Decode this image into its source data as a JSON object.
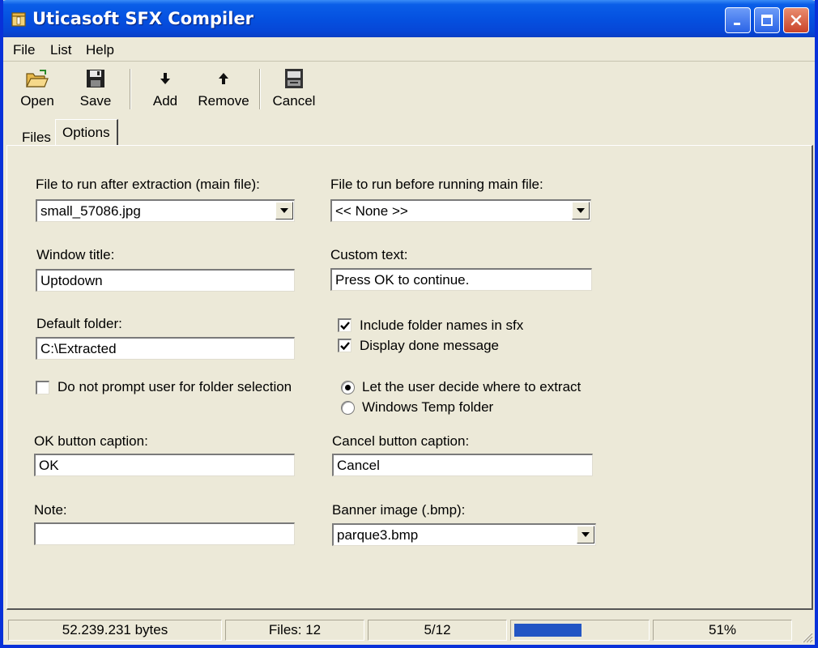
{
  "window": {
    "title": "Uticasoft SFX Compiler"
  },
  "menu": [
    "File",
    "List",
    "Help"
  ],
  "toolbar": {
    "open": "Open",
    "save": "Save",
    "add": "Add",
    "remove": "Remove",
    "cancel": "Cancel"
  },
  "tabs": {
    "files": "Files",
    "options": "Options"
  },
  "options": {
    "main_file_label": "File to run after extraction (main file):",
    "main_file_value": "small_57086.jpg",
    "pre_file_label": "File to run before running main file:",
    "pre_file_value": "<< None >>",
    "window_title_label": "Window title:",
    "window_title_value": "Uptodown",
    "custom_text_label": "Custom text:",
    "custom_text_value": "Press OK to continue.",
    "default_folder_label": "Default folder:",
    "default_folder_value": "C:\\Extracted",
    "include_folder_names_label": "Include folder names in sfx",
    "include_folder_names_checked": true,
    "display_done_label": "Display done message",
    "display_done_checked": true,
    "no_prompt_label": "Do not prompt user for folder selection",
    "no_prompt_checked": false,
    "radio_user_decide": "Let the user decide where to extract",
    "radio_temp_folder": "Windows Temp folder",
    "radio_selected": "user_decide",
    "ok_caption_label": "OK button caption:",
    "ok_caption_value": "OK",
    "cancel_caption_label": "Cancel button caption:",
    "cancel_caption_value": "Cancel",
    "note_label": "Note:",
    "note_value": "",
    "banner_label": "Banner image (.bmp):",
    "banner_value": "parque3.bmp"
  },
  "status": {
    "bytes": "52.239.231 bytes",
    "files": "Files: 12",
    "count": "5/12",
    "progress": 0.51,
    "percent": "51%"
  },
  "colors": {
    "titlebar": "#0551e0",
    "face": "#ece9d8",
    "progress": "#2356c4"
  }
}
